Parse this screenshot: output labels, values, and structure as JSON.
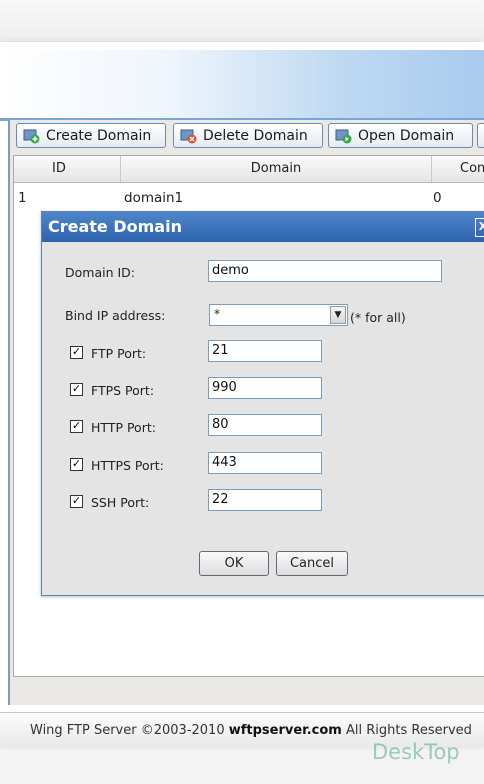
{
  "toolbar": {
    "create_label": "Create Domain",
    "delete_label": "Delete Domain",
    "open_label": "Open Domain"
  },
  "grid": {
    "columns": [
      "ID",
      "Domain",
      "Con"
    ],
    "rows": [
      {
        "id": "1",
        "domain": "domain1",
        "con": "0"
      }
    ]
  },
  "dialog": {
    "title": "Create Domain",
    "domain_id_label": "Domain ID:",
    "domain_id_value": "demo",
    "bind_ip_label": "Bind IP address:",
    "bind_ip_value": "*",
    "bind_ip_hint": "(* for all)",
    "ports": [
      {
        "label": "FTP Port:",
        "value": "21",
        "checked": true
      },
      {
        "label": "FTPS Port:",
        "value": "990",
        "checked": true
      },
      {
        "label": "HTTP Port:",
        "value": "80",
        "checked": true
      },
      {
        "label": "HTTPS Port:",
        "value": "443",
        "checked": true
      },
      {
        "label": "SSH Port:",
        "value": "22",
        "checked": true
      }
    ],
    "ok_label": "OK",
    "cancel_label": "Cancel",
    "close_glyph": "X"
  },
  "status": {
    "prefix": "Wing FTP Server ©2003-2010 ",
    "site": "wftpserver.com",
    "suffix": " All Rights Reserved"
  },
  "watermark": "DeskTop",
  "colors": {
    "title_bar": "#2d63ad",
    "accent": "#7aa6d6"
  }
}
